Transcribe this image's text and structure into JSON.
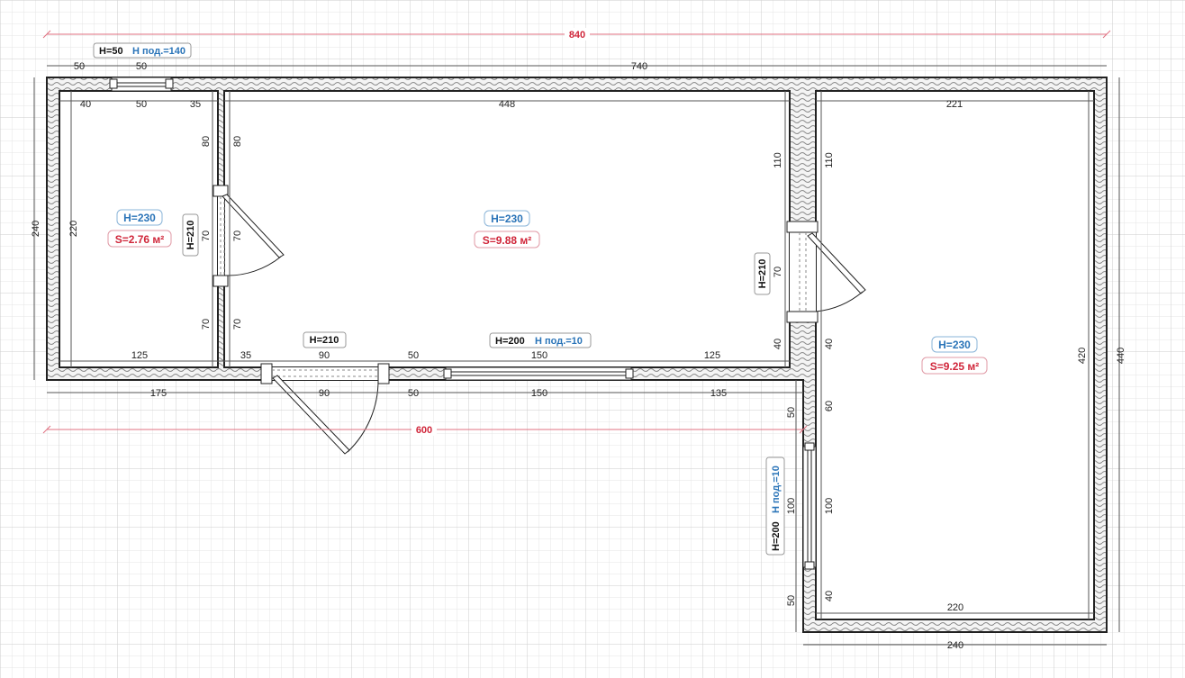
{
  "plan": {
    "overall": {
      "width_total": "840",
      "width_lower": "600",
      "height_total": "440"
    },
    "rooms": [
      {
        "height": "H=230",
        "area": "S=2.76 м²"
      },
      {
        "height": "H=230",
        "area": "S=9.88 м²"
      },
      {
        "height": "H=230",
        "area": "S=9.25 м²"
      }
    ],
    "windows": {
      "top": {
        "height": "H=50",
        "sill": "H под.=140"
      },
      "bottom": {
        "height": "H=200",
        "sill": "H под.=10"
      },
      "right": {
        "height": "H=200",
        "sill": "H под.=10"
      }
    },
    "doors": {
      "left": {
        "height": "H=210"
      },
      "bottom": {
        "height": "H=210"
      },
      "right": {
        "height": "H=210"
      }
    },
    "dims": {
      "top_a": "50",
      "top_b": "50",
      "top_c": "740",
      "in_l1": "40",
      "in_l2": "50",
      "in_l3": "35",
      "in_mid": "448",
      "in_right": "221",
      "left_outer": "240",
      "left_inner": "220",
      "lp_r_a": "80",
      "lp_r_b": "70",
      "lp_r_c": "70",
      "lp_l_a": "80",
      "lp_l_b": "70",
      "lp_l_c": "70",
      "rp_l_a": "110",
      "rp_l_b": "70",
      "rp_l_c": "40",
      "rp_r_a": "110",
      "rp_r_b": "40",
      "rp_r_c": "60",
      "rp_r_d": "100",
      "rp_r_e": "40",
      "rr_outer_a": "50",
      "rr_outer_b": "100",
      "rr_outer_c": "50",
      "right_inner": "420",
      "bot_in_a": "125",
      "bot_in_b": "35",
      "bot_in_c": "90",
      "bot_in_d": "50",
      "bot_in_e": "150",
      "bot_in_f": "125",
      "bot_out_a": "175",
      "bot_out_b": "90",
      "bot_out_c": "50",
      "bot_out_d": "150",
      "bot_out_e": "135",
      "rr_bottom_in": "220",
      "rr_bottom_out": "240"
    }
  }
}
